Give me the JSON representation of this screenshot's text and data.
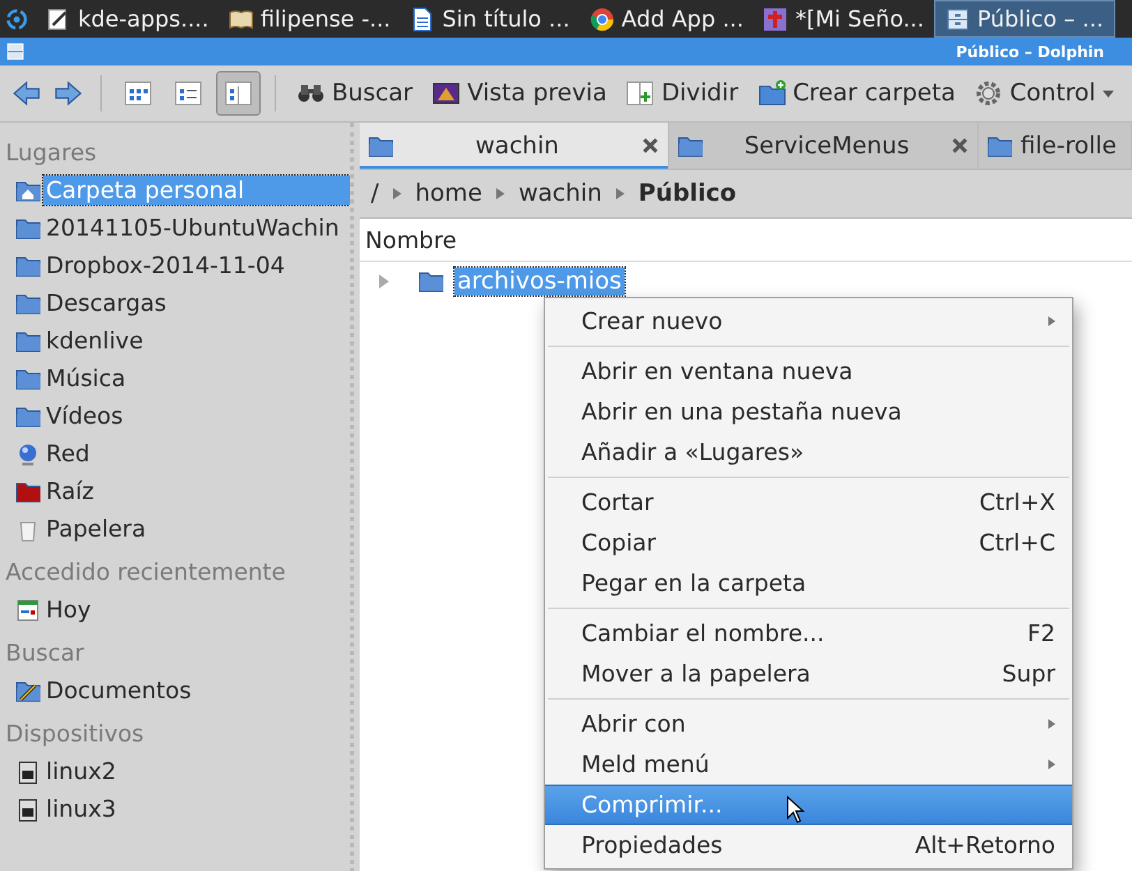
{
  "taskbar": {
    "tasks": [
      {
        "label": "kde-apps....",
        "kind": "editor",
        "selected": false
      },
      {
        "label": "filipense -...",
        "kind": "book",
        "selected": false
      },
      {
        "label": "Sin título ...",
        "kind": "document",
        "selected": false
      },
      {
        "label": "Add  App ...",
        "kind": "browser",
        "selected": false
      },
      {
        "label": "*[Mi Seño...",
        "kind": "image",
        "selected": false
      },
      {
        "label": "Público – ...",
        "kind": "filemanager",
        "selected": true
      }
    ]
  },
  "window": {
    "title": "Público – Dolphin"
  },
  "toolbar": {
    "view_modes": [
      {
        "kind": "icons",
        "selected": false
      },
      {
        "kind": "details",
        "selected": false
      },
      {
        "kind": "columns",
        "selected": true
      }
    ],
    "buttons": [
      {
        "label": "Buscar",
        "kind": "search"
      },
      {
        "label": "Vista previa",
        "kind": "preview"
      },
      {
        "label": "Dividir",
        "kind": "split"
      },
      {
        "label": "Crear carpeta",
        "kind": "newfolder"
      },
      {
        "label": "Control",
        "kind": "control"
      }
    ]
  },
  "sidebar": {
    "sections": [
      {
        "title": "Lugares",
        "items": [
          {
            "label": "Carpeta personal",
            "kind": "home",
            "selected": true
          },
          {
            "label": "20141105-UbuntuWachin",
            "kind": "folder",
            "selected": false
          },
          {
            "label": "Dropbox-2014-11-04",
            "kind": "folder",
            "selected": false
          },
          {
            "label": "Descargas",
            "kind": "folder",
            "selected": false
          },
          {
            "label": "kdenlive",
            "kind": "folder",
            "selected": false
          },
          {
            "label": "Música",
            "kind": "folder",
            "selected": false
          },
          {
            "label": "Vídeos",
            "kind": "folder",
            "selected": false
          },
          {
            "label": "Red",
            "kind": "network",
            "selected": false
          },
          {
            "label": "Raíz",
            "kind": "root",
            "selected": false
          },
          {
            "label": "Papelera",
            "kind": "trash",
            "selected": false
          }
        ]
      },
      {
        "title": "Accedido recientemente",
        "items": [
          {
            "label": "Hoy",
            "kind": "calendar",
            "selected": false
          }
        ]
      },
      {
        "title": "Buscar",
        "items": [
          {
            "label": "Documentos",
            "kind": "search",
            "selected": false
          }
        ]
      },
      {
        "title": "Dispositivos",
        "items": [
          {
            "label": "linux2",
            "kind": "drive",
            "selected": false
          },
          {
            "label": "linux3",
            "kind": "drive",
            "selected": false
          }
        ]
      }
    ]
  },
  "tabs": [
    {
      "label": "wachin",
      "selected": true
    },
    {
      "label": "ServiceMenus",
      "selected": false
    },
    {
      "label": "file-rolle",
      "selected": false
    }
  ],
  "breadcrumb": [
    {
      "label": "/",
      "current": false
    },
    {
      "label": "home",
      "current": false
    },
    {
      "label": "wachin",
      "current": false
    },
    {
      "label": "Público",
      "current": true
    }
  ],
  "file_list": {
    "columns": [
      "Nombre"
    ],
    "rows": [
      {
        "name": "archivos-mios",
        "selected": true,
        "expanded": false
      }
    ]
  },
  "context_menu": {
    "groups": [
      [
        {
          "label": "Crear nuevo",
          "has_submenu": true,
          "selected": false
        }
      ],
      [
        {
          "label": "Abrir en ventana nueva",
          "has_submenu": false,
          "selected": false
        },
        {
          "label": "Abrir en una pestaña nueva",
          "has_submenu": false,
          "selected": false
        },
        {
          "label": "Añadir a «Lugares»",
          "has_submenu": false,
          "selected": false
        }
      ],
      [
        {
          "label": "Cortar",
          "shortcut": "Ctrl+X",
          "has_submenu": false,
          "selected": false
        },
        {
          "label": "Copiar",
          "shortcut": "Ctrl+C",
          "has_submenu": false,
          "selected": false
        },
        {
          "label": "Pegar en la carpeta",
          "has_submenu": false,
          "selected": false
        }
      ],
      [
        {
          "label": "Cambiar el nombre...",
          "shortcut": "F2",
          "has_submenu": false,
          "selected": false
        },
        {
          "label": "Mover a la papelera",
          "shortcut": "Supr",
          "has_submenu": false,
          "selected": false
        }
      ],
      [
        {
          "label": "Abrir con",
          "has_submenu": true,
          "selected": false
        },
        {
          "label": "Meld menú",
          "has_submenu": true,
          "selected": false
        },
        {
          "label": "Comprimir...",
          "has_submenu": false,
          "selected": true
        },
        {
          "label": "Propiedades",
          "shortcut": "Alt+Retorno",
          "has_submenu": false,
          "selected": false
        }
      ]
    ]
  }
}
